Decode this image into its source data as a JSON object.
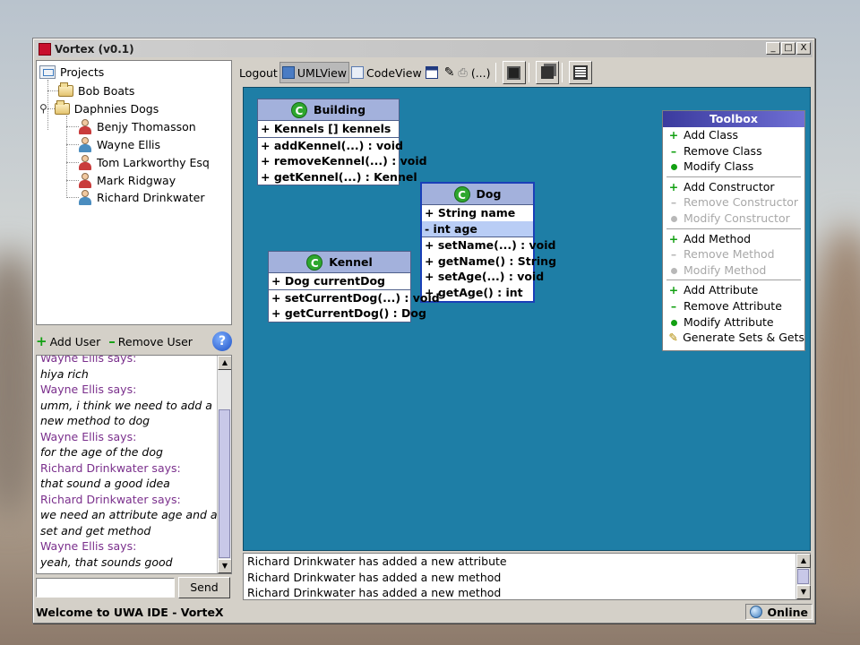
{
  "window": {
    "title": "Vortex (v0.1)",
    "controls": [
      "_",
      "□",
      "X"
    ]
  },
  "tree": {
    "root": "Projects",
    "projects": [
      {
        "label": "Bob Boats"
      },
      {
        "label": "Daphnies Dogs",
        "users": [
          "Benjy Thomasson",
          "Wayne Ellis",
          "Tom Larkworthy Esq",
          "Mark Ridgway",
          "Richard Drinkwater"
        ]
      }
    ]
  },
  "user_actions": {
    "add": "Add User",
    "remove": "Remove User",
    "help": "?"
  },
  "chat": {
    "lines": [
      {
        "kind": "name",
        "text": "Wayne Ellis says:"
      },
      {
        "kind": "msg",
        "text": "hiya rich"
      },
      {
        "kind": "name",
        "text": "Wayne Ellis says:"
      },
      {
        "kind": "msg",
        "text": "umm, i think we need to add a"
      },
      {
        "kind": "msg",
        "text": "new method to dog"
      },
      {
        "kind": "name",
        "text": "Wayne Ellis says:"
      },
      {
        "kind": "msg",
        "text": "for the age of the dog"
      },
      {
        "kind": "name",
        "text": "Richard Drinkwater says:"
      },
      {
        "kind": "msg",
        "text": "that sound a good idea"
      },
      {
        "kind": "name",
        "text": "Richard Drinkwater says:"
      },
      {
        "kind": "msg",
        "text": "we need an attribute age and a"
      },
      {
        "kind": "msg",
        "text": "set and get method"
      },
      {
        "kind": "name",
        "text": "Wayne Ellis says:"
      },
      {
        "kind": "msg",
        "text": "yeah, that sounds good"
      }
    ],
    "input_value": "",
    "send": "Send"
  },
  "toolbar": {
    "logout": "Logout",
    "uml_view": "UMLView",
    "code_view": "CodeView",
    "ellipsis": "(...)"
  },
  "classes": [
    {
      "name": "Building",
      "attributes": [
        "+ Kennels [] kennels"
      ],
      "methods": [
        "+ addKennel(...) : void",
        "+ removeKennel(...) : void",
        "+ getKennel(...) : Kennel"
      ]
    },
    {
      "name": "Dog",
      "attributes": [
        "+ String name",
        "- int age"
      ],
      "methods": [
        "+ setName(...) : void",
        "+ getName() : String",
        "+ setAge(...) : void",
        "+ getAge() : int"
      ]
    },
    {
      "name": "Kennel",
      "attributes": [
        "+ Dog currentDog"
      ],
      "methods": [
        "+ setCurrentDog(...) : void",
        "+ getCurrentDog() : Dog"
      ]
    }
  ],
  "toolbox": {
    "title": "Toolbox",
    "groups": [
      [
        "Add Class",
        "Remove Class",
        "Modify Class"
      ],
      [
        "Add Constructor",
        "Remove Constructor",
        "Modify Constructor"
      ],
      [
        "Add Method",
        "Remove Method",
        "Modify Method"
      ],
      [
        "Add Attribute",
        "Remove Attribute",
        "Modify Attribute",
        "Generate Sets & Gets"
      ]
    ]
  },
  "log": {
    "lines": [
      "Richard Drinkwater has added a new attribute",
      "Richard Drinkwater has added a new method",
      "Richard Drinkwater has added a new method"
    ]
  },
  "status": {
    "text": "Welcome to UWA IDE - VorteX",
    "connection": "Online"
  },
  "colors": {
    "canvas": "#1e7ea6",
    "class_header": "#a3b1dc",
    "chat_name": "#7a2f8c",
    "accent_green": "#12a012"
  }
}
